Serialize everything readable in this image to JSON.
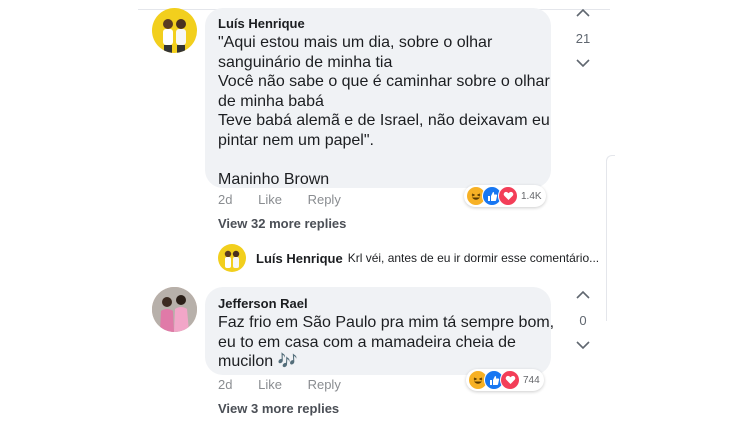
{
  "comments": [
    {
      "author": "Luís Henrique",
      "text": "\"Aqui estou mais um dia, sobre o olhar\nsanguinário de minha tia\nVocê não sabe o que é caminhar sobre o olhar\nde minha babá\nTeve babá alemã e de Israel, não deixavam eu\npintar nem um papel\".\n\nManinho Brown",
      "time": "2d",
      "like_label": "Like",
      "reply_label": "Reply",
      "vote_count": "21",
      "reactions": [
        "haha",
        "like",
        "love"
      ],
      "reaction_count": "1.4K",
      "more_replies": "View 32 more replies",
      "reply_preview": {
        "author": "Luís Henrique",
        "text": "Krl véi, antes de eu ir dormir esse comentário..."
      }
    },
    {
      "author": "Jefferson Rael",
      "text": "Faz frio em São Paulo pra mim tá sempre bom,\neu to em casa com a mamadeira cheia de\nmucilon 🎶",
      "time": "2d",
      "like_label": "Like",
      "reply_label": "Reply",
      "vote_count": "0",
      "reactions": [
        "haha",
        "like",
        "love"
      ],
      "reaction_count": "744",
      "more_replies": "View 3 more replies"
    }
  ],
  "colors": {
    "bubble": "#f0f2f5",
    "like_blue": "#1877f2",
    "love_red": "#f33e58",
    "haha_yellow": "#f7b125",
    "avatar1_bg": "#f2cf1d"
  }
}
